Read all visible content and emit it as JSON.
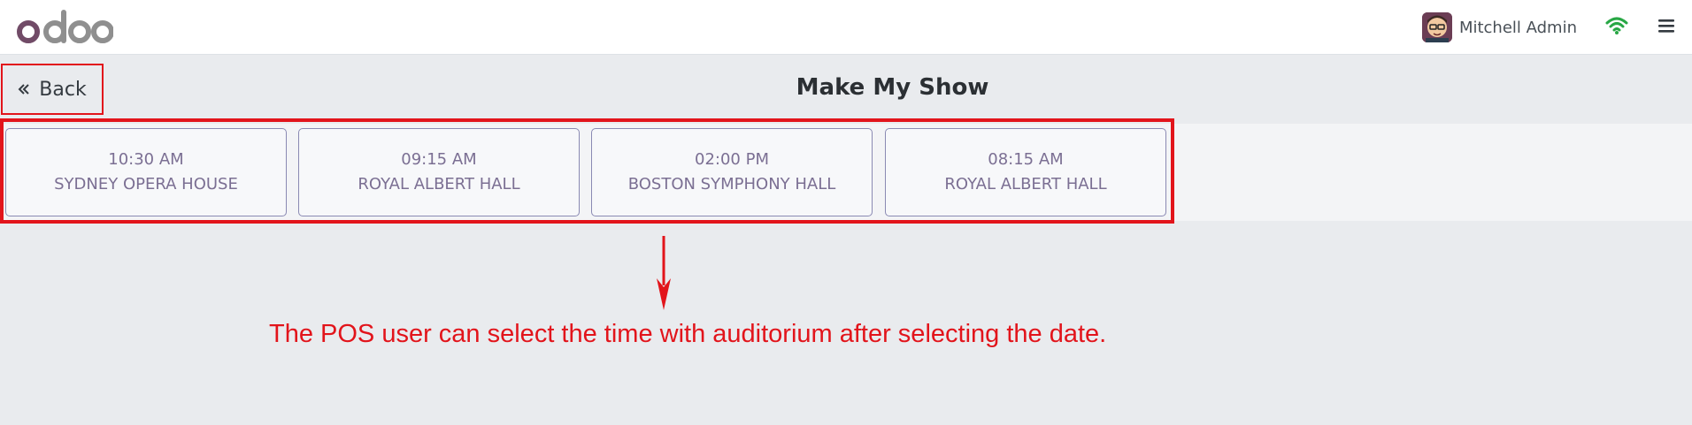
{
  "navbar": {
    "logo_text": "odoo",
    "user_name": "Mitchell Admin"
  },
  "header": {
    "back_label": "Back",
    "title": "Make My Show"
  },
  "slots": [
    {
      "time": "10:30 AM",
      "venue": "SYDNEY OPERA HOUSE"
    },
    {
      "time": "09:15 AM",
      "venue": "ROYAL ALBERT HALL"
    },
    {
      "time": "02:00 PM",
      "venue": "BOSTON SYMPHONY HALL"
    },
    {
      "time": "08:15 AM",
      "venue": "ROYAL ALBERT HALL"
    }
  ],
  "annotation": {
    "text": "The POS user can select the time with auditorium after selecting the date."
  },
  "colors": {
    "highlight_red": "#e2141b",
    "slot_border": "#8a8ab3",
    "slot_text": "#7b6f93",
    "wifi_green": "#28a745",
    "logo_purple": "#714b67",
    "logo_gray": "#8f8f8f"
  },
  "icons": {
    "back": "double-chevron-left-icon",
    "wifi": "wifi-icon",
    "menu": "hamburger-menu-icon"
  }
}
